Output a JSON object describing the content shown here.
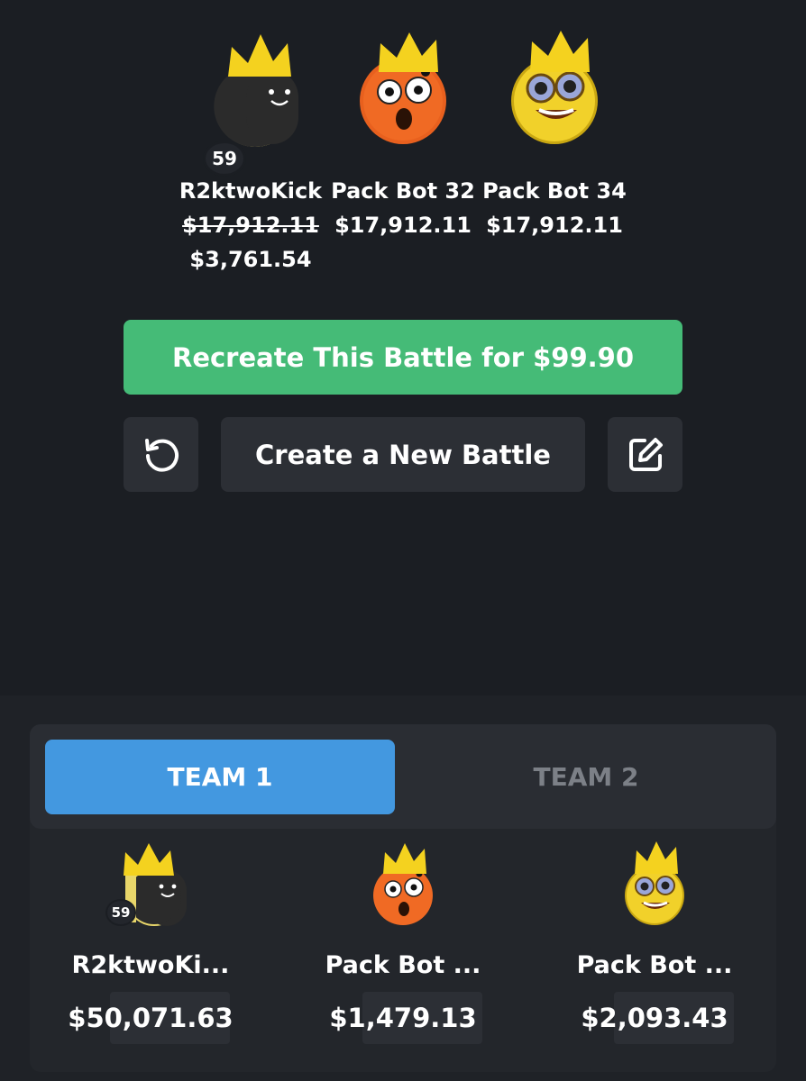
{
  "winners": [
    {
      "name": "R2ktwoKick",
      "level": "59",
      "original_amount": "$17,912.11",
      "amount": "$3,761.54",
      "avatar_icon": "dark-smiley-crown-icon"
    },
    {
      "name": "Pack Bot 32",
      "amount": "$17,912.11",
      "avatar_icon": "surprised-orange-crown-icon"
    },
    {
      "name": "Pack Bot 34",
      "amount": "$17,912.11",
      "avatar_icon": "goggle-eyed-yellow-crown-icon"
    }
  ],
  "actions": {
    "recreate_label": "Recreate This Battle for $99.90",
    "create_label": "Create a New Battle",
    "replay_icon": "replay-icon",
    "edit_icon": "edit-icon"
  },
  "tabs": [
    {
      "label": "TEAM 1",
      "active": true
    },
    {
      "label": "TEAM 2",
      "active": false
    }
  ],
  "team_players": [
    {
      "name": "R2ktwoKi...",
      "level": "59",
      "value": "$50,071.63"
    },
    {
      "name": "Pack Bot ...",
      "value": "$1,479.13"
    },
    {
      "name": "Pack Bot ...",
      "value": "$2,093.43"
    }
  ],
  "colors": {
    "background": "#1b1e23",
    "recreate_green": "#45bb77",
    "tab_active_blue": "#4398e0",
    "crown_yellow": "#f4d21f",
    "button_gray": "#2c2f35"
  }
}
